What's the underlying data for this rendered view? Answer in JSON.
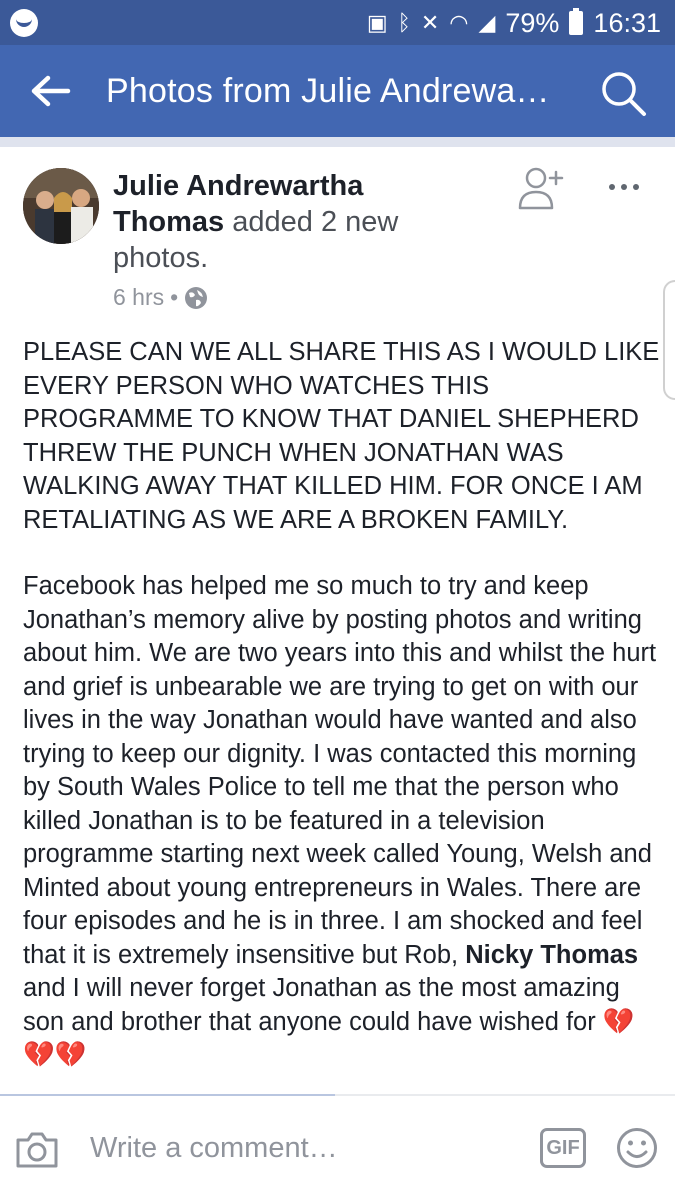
{
  "status_bar": {
    "battery_percent": "79%",
    "time": "16:31",
    "icons": [
      "messenger-icon",
      "battery-saver-icon",
      "bluetooth-icon",
      "vibrate-off-icon",
      "wifi-icon",
      "signal-icon",
      "battery-icon"
    ]
  },
  "app_bar": {
    "title": "Photos from Julie Andrewa…",
    "back_icon": "arrow-left-icon",
    "search_icon": "search-icon"
  },
  "post": {
    "author_name": "Julie Andrewartha Thomas",
    "action": "added 2 new photos.",
    "time": "6 hrs",
    "separator": "•",
    "privacy_icon": "globe-icon",
    "paragraph1": "PLEASE CAN WE ALL SHARE THIS AS I WOULD LIKE EVERY PERSON WHO WATCHES THIS PROGRAMME TO KNOW THAT DANIEL SHEPHERD THREW THE PUNCH WHEN JONATHAN WAS WALKING AWAY THAT KILLED HIM.  FOR ONCE I AM RETALIATING AS WE ARE A BROKEN FAMILY.",
    "paragraph2_part1": "Facebook has helped me so much to try and keep Jonathan’s memory alive by posting photos and writing about him.  We are two years into this and whilst the hurt and grief is unbearable we are trying to get on with our lives in the way Jonathan would have wanted and also trying to keep our dignity.  I was contacted this morning by South Wales Police to tell me that the person who killed Jonathan is to be featured in a television programme starting next week called Young, Welsh and Minted about young entrepreneurs in Wales.  There are four episodes and he is in three.  I am shocked and feel that it is extremely insensitive but Rob, ",
    "tagged_name": "Nicky Thomas",
    "paragraph2_part2": " and I will never forget Jonathan as the most amazing son and brother that anyone could have wished for ",
    "emoji": "💔💔💔"
  },
  "comment_bar": {
    "placeholder": "Write a comment…",
    "gif_label": "GIF",
    "camera_icon": "camera-icon",
    "emoji_icon": "smiley-icon"
  },
  "colors": {
    "status_bar": "#3b5998",
    "app_bar": "#4267b2",
    "secondary_text": "#90949c",
    "heart": "#e0457b"
  }
}
